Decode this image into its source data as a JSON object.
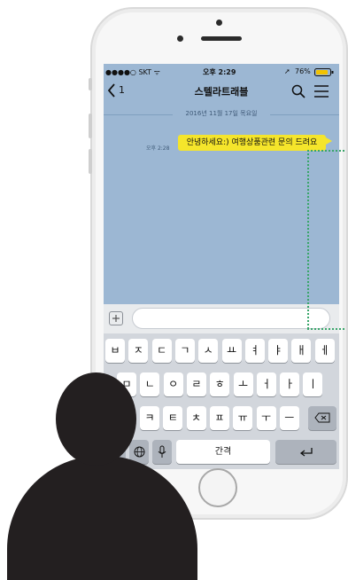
{
  "status_bar": {
    "carrier": "●●●●○ SKT ᯤ",
    "time": "오후 2:29",
    "battery": "76%"
  },
  "navbar": {
    "back_label": "1",
    "title": "스텔라트래블"
  },
  "chat": {
    "date_divider": "2016년 11월 17일 목요일",
    "message_time": "오후 2:28",
    "message_text": "안녕하세요:) 여행상품관련 문의 드려요"
  },
  "keyboard": {
    "row1": [
      "ㅂ",
      "ㅈ",
      "ㄷ",
      "ㄱ",
      "ㅅ",
      "ㅛ",
      "ㅕ",
      "ㅑ",
      "ㅐ",
      "ㅔ"
    ],
    "row2": [
      "ㅁ",
      "ㄴ",
      "ㅇ",
      "ㄹ",
      "ㅎ",
      "ㅗ",
      "ㅓ",
      "ㅏ",
      "ㅣ"
    ],
    "row3": [
      "ㅋ",
      "ㅌ",
      "ㅊ",
      "ㅍ",
      "ㅠ",
      "ㅜ",
      "ㅡ"
    ],
    "space_label": "간격"
  },
  "colors": {
    "chat_background": "#9cb7d3",
    "bubble": "#f5e52b",
    "annotation": "#3aa66b",
    "silhouette": "#231f20"
  }
}
